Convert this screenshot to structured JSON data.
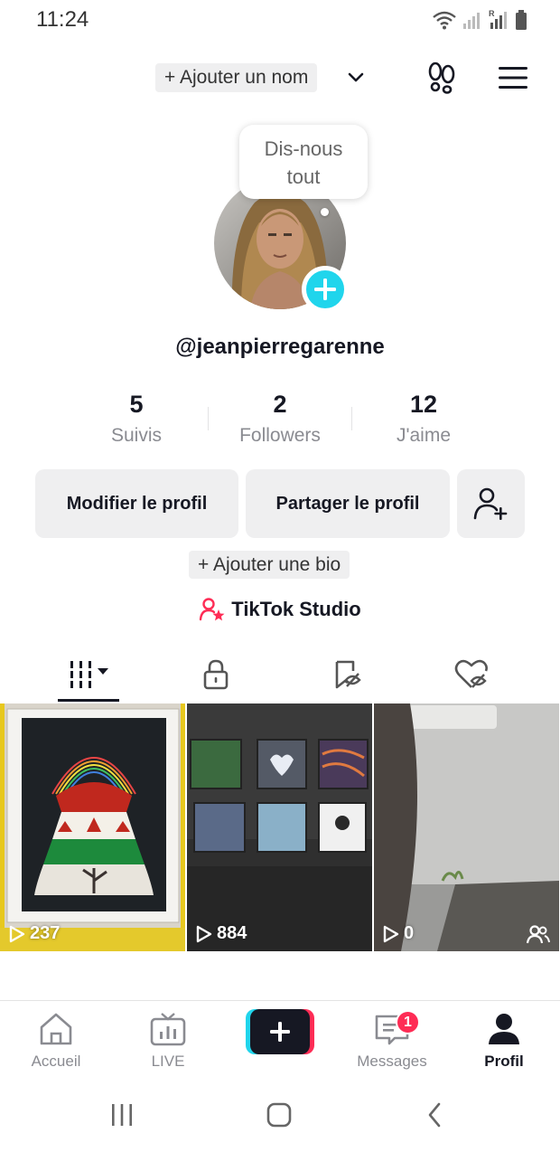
{
  "status": {
    "time": "11:24"
  },
  "header": {
    "add_name": "+ Ajouter un nom"
  },
  "bubble": {
    "text_line1": "Dis-nous",
    "text_line2": "tout"
  },
  "profile": {
    "username": "@jeanpierregarenne"
  },
  "stats": [
    {
      "value": "5",
      "label": "Suivis"
    },
    {
      "value": "2",
      "label": "Followers"
    },
    {
      "value": "12",
      "label": "J'aime"
    }
  ],
  "buttons": {
    "edit": "Modifier le profil",
    "share": "Partager le profil"
  },
  "bio": {
    "add_bio": "+ Ajouter une bio"
  },
  "studio": {
    "label": "TikTok Studio"
  },
  "videos": [
    {
      "views": "237"
    },
    {
      "views": "884"
    },
    {
      "views": "0"
    }
  ],
  "nav": {
    "home": "Accueil",
    "live": "LIVE",
    "messages": "Messages",
    "messages_badge": "1",
    "profile": "Profil"
  },
  "colors": {
    "accent_cyan": "#20d5ec",
    "accent_red": "#fe2c55",
    "text": "#161823",
    "muted": "#8a8b91"
  }
}
